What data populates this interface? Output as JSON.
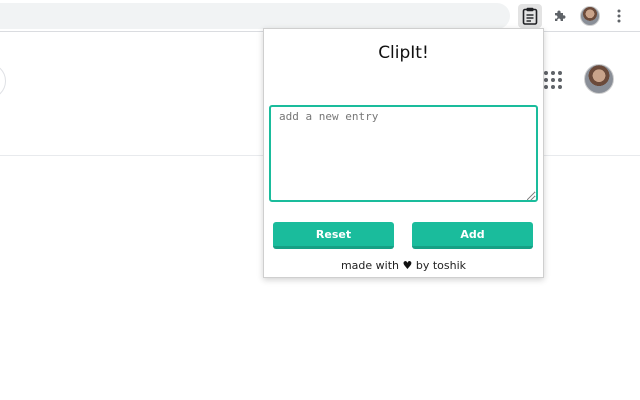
{
  "popup": {
    "title": "ClipIt!",
    "entry_placeholder": "add a new entry",
    "entry_value": "",
    "reset_label": "Reset",
    "add_label": "Add",
    "footer_prefix": "made with",
    "footer_heart": "♥",
    "footer_suffix": "by toshik",
    "accent_color": "#1abc9c"
  },
  "toolbar": {
    "icons": [
      "clipboard-icon",
      "puzzle-icon",
      "profile-avatar",
      "more-vert-icon"
    ]
  },
  "page": {
    "icons": [
      "apps-grid-icon",
      "account-avatar"
    ]
  }
}
